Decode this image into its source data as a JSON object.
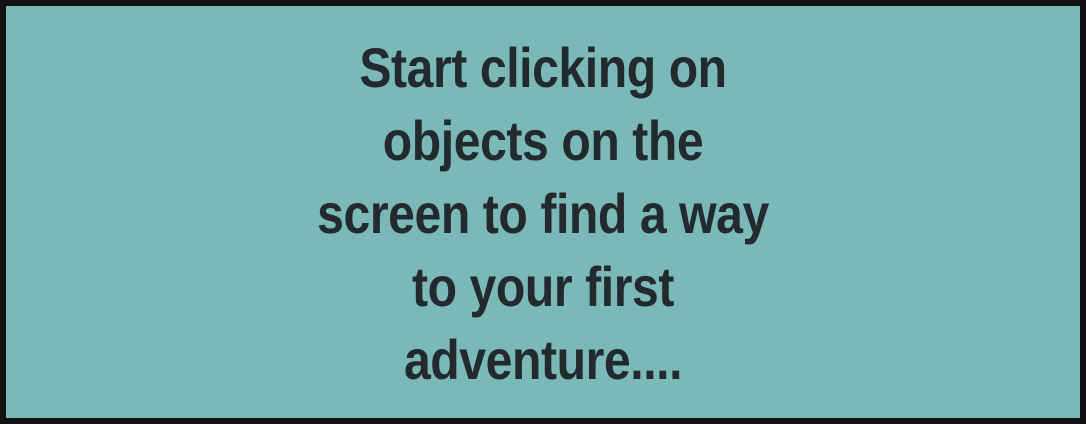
{
  "dialog": {
    "lines": [
      "Start clicking on",
      "objects on the",
      "screen to find a way",
      "to your first",
      "adventure...."
    ]
  },
  "colors": {
    "panel_background": "#7bb8b8",
    "panel_border": "#111111",
    "text": "#232a2e"
  }
}
